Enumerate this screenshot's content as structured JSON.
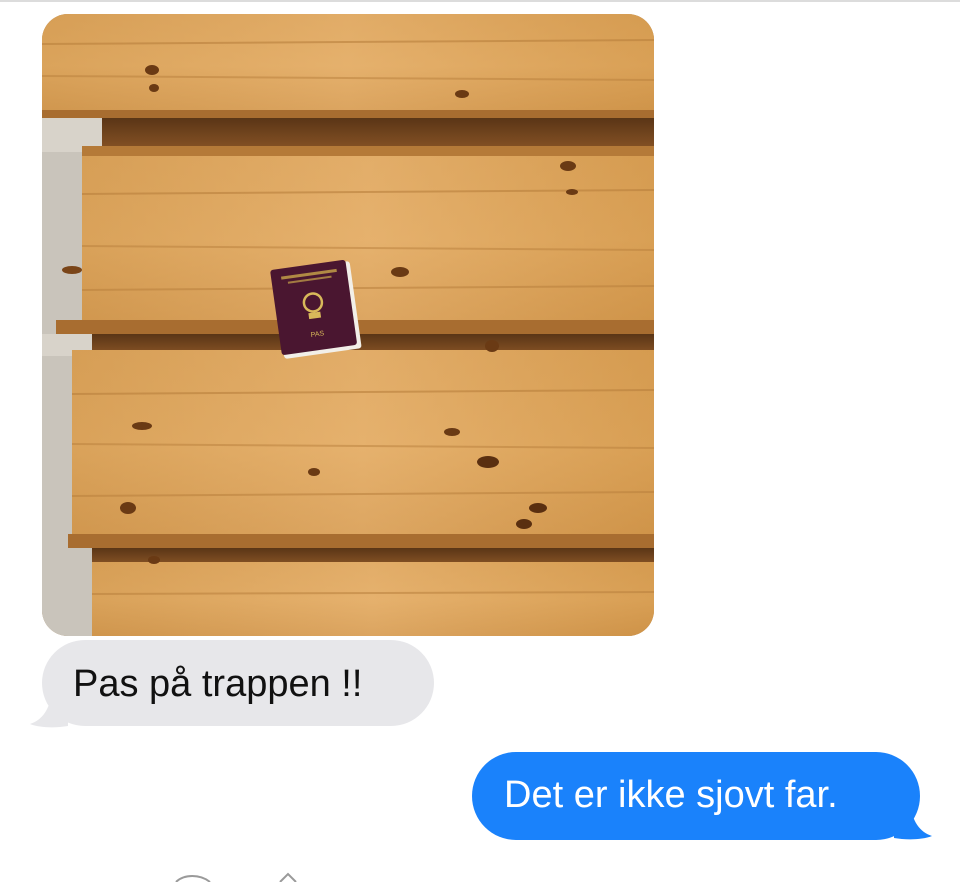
{
  "conversation": {
    "photo": {
      "description_icon": "photo-attachment"
    },
    "messages": [
      {
        "sender": "other",
        "text": "Pas på trappen !!"
      },
      {
        "sender": "me",
        "text": "Det er ikke sjovt far."
      }
    ]
  },
  "colors": {
    "incoming_bubble": "#e7e7ea",
    "outgoing_bubble": "#1a82fb",
    "incoming_text": "#111111",
    "outgoing_text": "#ffffff",
    "passport_cover": "#4a1630"
  },
  "passport": {
    "label": "PAS"
  }
}
